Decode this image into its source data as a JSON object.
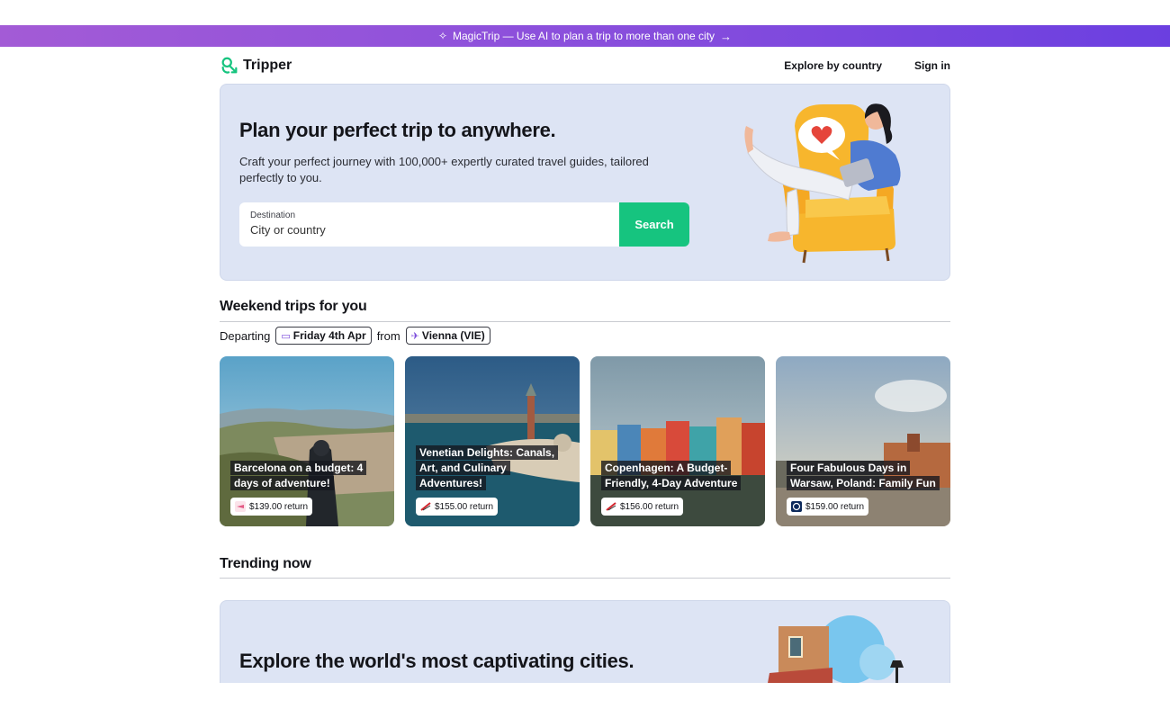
{
  "promo": {
    "text": "MagicTrip — Use AI to plan a trip to more than one city",
    "icon": "sparkle-icon"
  },
  "nav": {
    "brand": "Tripper",
    "explore": "Explore by country",
    "signin": "Sign in"
  },
  "hero": {
    "title": "Plan your perfect trip to anywhere.",
    "subtitle": "Craft your perfect journey with 100,000+ expertly curated travel guides, tailored perfectly to you.",
    "destination_label": "Destination",
    "destination_placeholder": "City or country",
    "search_label": "Search"
  },
  "weekend": {
    "title": "Weekend trips for you",
    "departing_label": "Departing",
    "date": "Friday 4th Apr",
    "from_label": "from",
    "origin": "Vienna (VIE)",
    "cards": [
      {
        "title": "Barcelona on a budget: 4 days of adventure!",
        "price": "$139.00 return"
      },
      {
        "title": "Venetian Delights: Canals, Art, and Culinary Adventures!",
        "price": "$155.00 return"
      },
      {
        "title": "Copenhagen: A Budget-Friendly, 4-Day Adventure",
        "price": "$156.00 return"
      },
      {
        "title": "Four Fabulous Days in Warsaw, Poland: Family Fun",
        "price": "$159.00 return"
      }
    ]
  },
  "trending": {
    "title": "Trending now",
    "banner_title": "Explore the world's most captivating cities."
  },
  "colors": {
    "accent_green": "#16c47f",
    "promo_purple": "#8a4fdc",
    "hero_bg": "#dde4f4"
  }
}
